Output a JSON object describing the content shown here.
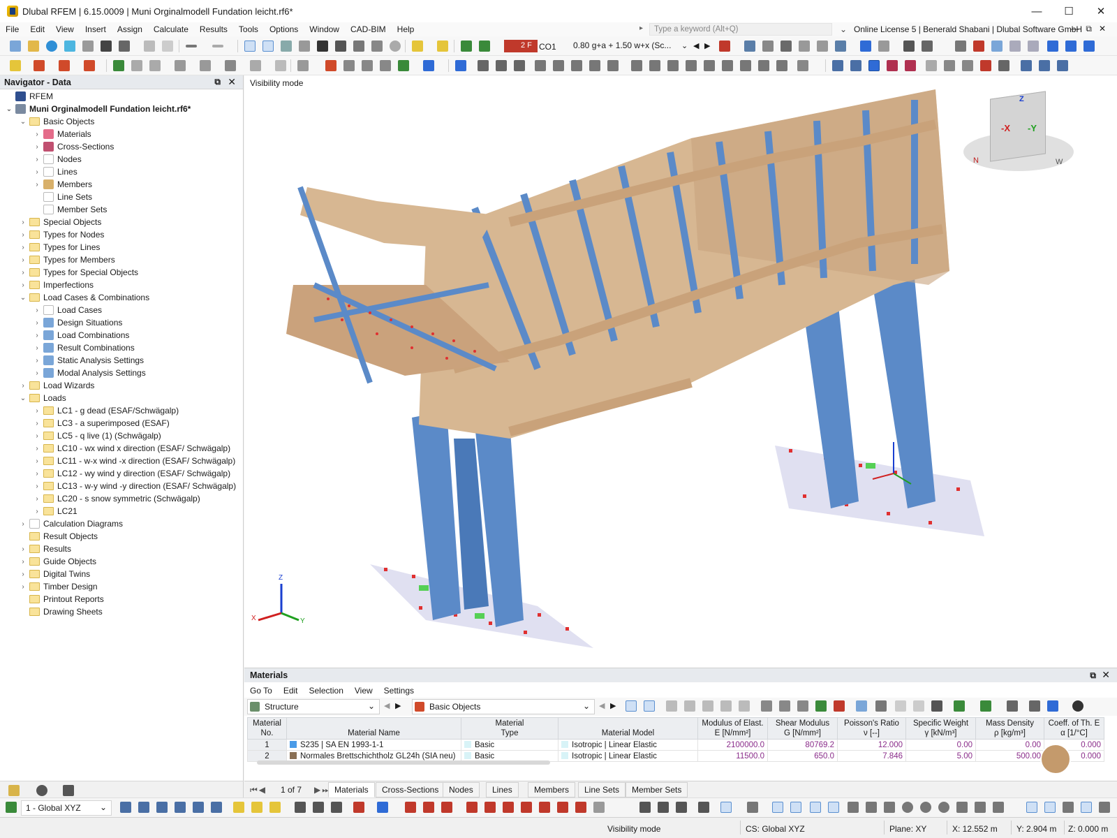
{
  "window": {
    "title": "Dlubal RFEM | 6.15.0009 | Muni Orginalmodell Fundation leicht.rf6*"
  },
  "menu": [
    "File",
    "Edit",
    "View",
    "Insert",
    "Assign",
    "Calculate",
    "Results",
    "Tools",
    "Options",
    "Window",
    "CAD-BIM",
    "Help"
  ],
  "search": {
    "placeholder": "Type a keyword (Alt+Q)"
  },
  "license": "Online License 5 | Benerald Shabani | Dlubal Software GmbH",
  "toolbar": {
    "load_badge": "2 F",
    "load_case": "CO1",
    "combination": "0.80 g+a + 1.50 w+x (Sc..."
  },
  "navigator": {
    "title": "Navigator - Data",
    "items": [
      {
        "label": "RFEM",
        "level": 0,
        "arrow": "",
        "icon": "rfem-icon",
        "bold": false
      },
      {
        "label": "Muni Orginalmodell Fundation leicht.rf6*",
        "level": 0,
        "arrow": "⌄",
        "icon": "model-icon",
        "bold": true
      },
      {
        "label": "Basic Objects",
        "level": 1,
        "arrow": "⌄",
        "icon": "folder",
        "bold": false
      },
      {
        "label": "Materials",
        "level": 2,
        "arrow": "›",
        "icon": "materials-icon",
        "bold": false
      },
      {
        "label": "Cross-Sections",
        "level": 2,
        "arrow": "›",
        "icon": "cross-sections-icon",
        "bold": false
      },
      {
        "label": "Nodes",
        "level": 2,
        "arrow": "›",
        "icon": "nodes-icon",
        "bold": false
      },
      {
        "label": "Lines",
        "level": 2,
        "arrow": "›",
        "icon": "lines-icon",
        "bold": false
      },
      {
        "label": "Members",
        "level": 2,
        "arrow": "›",
        "icon": "members-icon",
        "bold": false
      },
      {
        "label": "Line Sets",
        "level": 2,
        "arrow": "",
        "icon": "line-sets-icon",
        "bold": false
      },
      {
        "label": "Member Sets",
        "level": 2,
        "arrow": "",
        "icon": "member-sets-icon",
        "bold": false
      },
      {
        "label": "Special Objects",
        "level": 1,
        "arrow": "›",
        "icon": "folder",
        "bold": false
      },
      {
        "label": "Types for Nodes",
        "level": 1,
        "arrow": "›",
        "icon": "folder",
        "bold": false
      },
      {
        "label": "Types for Lines",
        "level": 1,
        "arrow": "›",
        "icon": "folder",
        "bold": false
      },
      {
        "label": "Types for Members",
        "level": 1,
        "arrow": "›",
        "icon": "folder",
        "bold": false
      },
      {
        "label": "Types for Special Objects",
        "level": 1,
        "arrow": "›",
        "icon": "folder",
        "bold": false
      },
      {
        "label": "Imperfections",
        "level": 1,
        "arrow": "›",
        "icon": "folder",
        "bold": false
      },
      {
        "label": "Load Cases & Combinations",
        "level": 1,
        "arrow": "⌄",
        "icon": "folder",
        "bold": false
      },
      {
        "label": "Load Cases",
        "level": 2,
        "arrow": "›",
        "icon": "load-cases-icon",
        "bold": false
      },
      {
        "label": "Design Situations",
        "level": 2,
        "arrow": "›",
        "icon": "design-situations-icon",
        "bold": false
      },
      {
        "label": "Load Combinations",
        "level": 2,
        "arrow": "›",
        "icon": "load-combinations-icon",
        "bold": false
      },
      {
        "label": "Result Combinations",
        "level": 2,
        "arrow": "›",
        "icon": "result-combinations-icon",
        "bold": false
      },
      {
        "label": "Static Analysis Settings",
        "level": 2,
        "arrow": "›",
        "icon": "static-analysis-icon",
        "bold": false
      },
      {
        "label": "Modal Analysis Settings",
        "level": 2,
        "arrow": "›",
        "icon": "modal-analysis-icon",
        "bold": false
      },
      {
        "label": "Load Wizards",
        "level": 1,
        "arrow": "›",
        "icon": "folder",
        "bold": false
      },
      {
        "label": "Loads",
        "level": 1,
        "arrow": "⌄",
        "icon": "folder",
        "bold": false
      },
      {
        "label": "LC1 - g dead (ESAF/Schwägalp)",
        "level": 2,
        "arrow": "›",
        "icon": "folder",
        "bold": false
      },
      {
        "label": "LC3 - a superimposed (ESAF)",
        "level": 2,
        "arrow": "›",
        "icon": "folder",
        "bold": false
      },
      {
        "label": "LC5 - q live (1) (Schwägalp)",
        "level": 2,
        "arrow": "›",
        "icon": "folder",
        "bold": false
      },
      {
        "label": "LC10 - wx wind x direction (ESAF/ Schwägalp)",
        "level": 2,
        "arrow": "›",
        "icon": "folder",
        "bold": false
      },
      {
        "label": "LC11 - w-x wind -x direction (ESAF/ Schwägalp)",
        "level": 2,
        "arrow": "›",
        "icon": "folder",
        "bold": false
      },
      {
        "label": "LC12 - wy wind y direction (ESAF/ Schwägalp)",
        "level": 2,
        "arrow": "›",
        "icon": "folder",
        "bold": false
      },
      {
        "label": "LC13 - w-y wind -y direction (ESAF/ Schwägalp)",
        "level": 2,
        "arrow": "›",
        "icon": "folder",
        "bold": false
      },
      {
        "label": "LC20 - s snow symmetric (Schwägalp)",
        "level": 2,
        "arrow": "›",
        "icon": "folder",
        "bold": false
      },
      {
        "label": "LC21",
        "level": 2,
        "arrow": "›",
        "icon": "folder",
        "bold": false
      },
      {
        "label": "Calculation Diagrams",
        "level": 1,
        "arrow": "›",
        "icon": "calc-diagrams-icon",
        "bold": false
      },
      {
        "label": "Result Objects",
        "level": 1,
        "arrow": "",
        "icon": "folder",
        "bold": false
      },
      {
        "label": "Results",
        "level": 1,
        "arrow": "›",
        "icon": "folder",
        "bold": false
      },
      {
        "label": "Guide Objects",
        "level": 1,
        "arrow": "›",
        "icon": "folder",
        "bold": false
      },
      {
        "label": "Digital Twins",
        "level": 1,
        "arrow": "›",
        "icon": "folder",
        "bold": false
      },
      {
        "label": "Timber Design",
        "level": 1,
        "arrow": "›",
        "icon": "folder",
        "bold": false
      },
      {
        "label": "Printout Reports",
        "level": 1,
        "arrow": "",
        "icon": "folder",
        "bold": false
      },
      {
        "label": "Drawing Sheets",
        "level": 1,
        "arrow": "",
        "icon": "folder",
        "bold": false
      }
    ]
  },
  "viewport": {
    "mode_label": "Visibility mode",
    "axes": {
      "x": "X",
      "y": "Y",
      "z": "Z"
    },
    "viewcube": {
      "x": "-X",
      "y": "-Y",
      "z": "Z",
      "n": "N",
      "w": "W"
    }
  },
  "materials_panel": {
    "title": "Materials",
    "menu": [
      "Go To",
      "Edit",
      "Selection",
      "View",
      "Settings"
    ],
    "structure_combo": "Structure",
    "filter_combo": "Basic Objects",
    "columns": [
      {
        "l1": "Material",
        "l2": "No."
      },
      {
        "l1": "",
        "l2": "Material Name"
      },
      {
        "l1": "Material",
        "l2": "Type"
      },
      {
        "l1": "",
        "l2": "Material Model"
      },
      {
        "l1": "Modulus of Elast.",
        "l2": "E [N/mm²]"
      },
      {
        "l1": "Shear Modulus",
        "l2": "G [N/mm²]"
      },
      {
        "l1": "Poisson's Ratio",
        "l2": "ν [--]"
      },
      {
        "l1": "Specific Weight",
        "l2": "γ [kN/m³]"
      },
      {
        "l1": "Mass Density",
        "l2": "ρ [kg/m³]"
      },
      {
        "l1": "Coeff. of Th. E",
        "l2": "α [1/°C]"
      }
    ],
    "rows": [
      {
        "no": "1",
        "name": "S235 | SA EN 1993-1-1",
        "color": "#4a9be8",
        "type": "Basic",
        "model": "Isotropic | Linear Elastic",
        "E": "2100000.0",
        "G": "80769.2",
        "nu": "12.000",
        "gamma": "0.00",
        "rho": "0.00",
        "alpha": "0.000"
      },
      {
        "no": "2",
        "name": "Normales Brettschichtholz GL24h (SIA neu)",
        "color": "#8a7055",
        "type": "Basic",
        "model": "Isotropic | Linear Elastic",
        "E": "11500.0",
        "G": "650.0",
        "nu": "7.846",
        "gamma": "5.00",
        "rho": "500.00",
        "alpha": "0.000"
      }
    ],
    "pager": "1 of 7",
    "tabs": [
      "Materials",
      "Cross-Sections",
      "Nodes",
      "Lines",
      "Members",
      "Line Sets",
      "Member Sets"
    ]
  },
  "bottom_toolbar": {
    "view_combo": "1 - Global XYZ"
  },
  "statusbar": {
    "mode": "Visibility mode",
    "cs": "CS: Global XYZ",
    "plane": "Plane: XY",
    "x": "X: 12.552 m",
    "y": "Y: 2.904 m",
    "z": "Z: 0.000 m"
  },
  "colors": {
    "steel": "#5b8ac8",
    "timber": "#d7b792",
    "panel_header": "#e7eaee",
    "accent": "#2f6bd6"
  }
}
